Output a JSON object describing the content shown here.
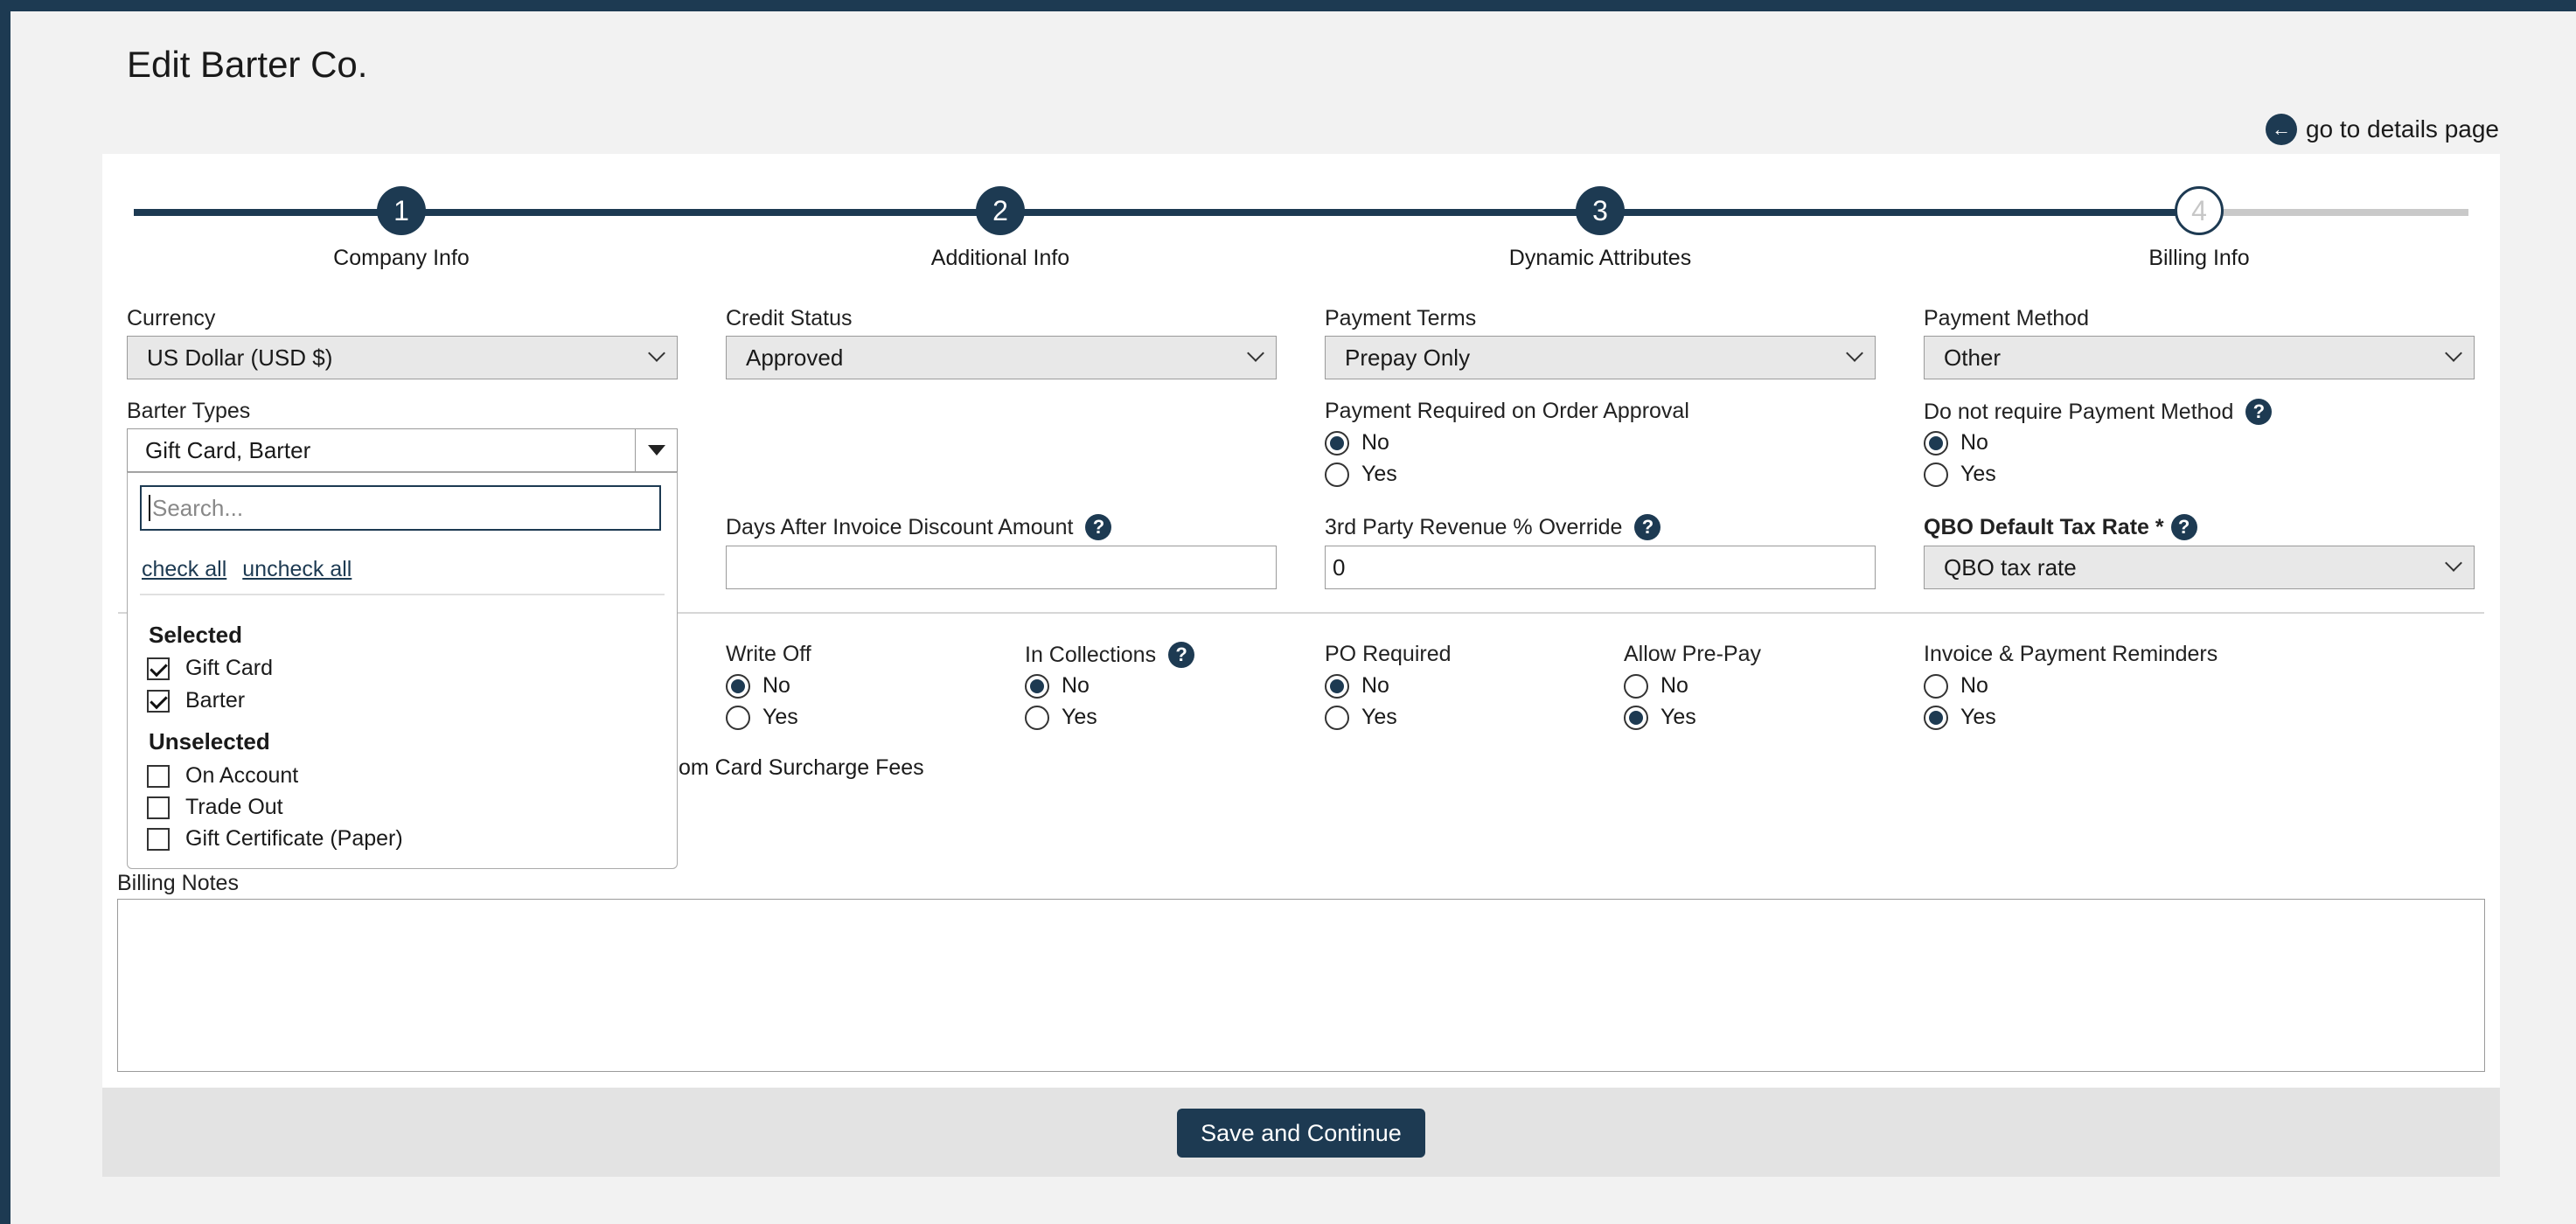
{
  "page": {
    "title": "Edit Barter Co.",
    "details_link": "go to details page"
  },
  "steps": [
    {
      "num": "1",
      "label": "Company Info"
    },
    {
      "num": "2",
      "label": "Additional Info"
    },
    {
      "num": "3",
      "label": "Dynamic Attributes"
    },
    {
      "num": "4",
      "label": "Billing Info"
    }
  ],
  "fields": {
    "currency": {
      "label": "Currency",
      "value": "US Dollar (USD $)"
    },
    "credit_status": {
      "label": "Credit Status",
      "value": "Approved"
    },
    "payment_terms": {
      "label": "Payment Terms",
      "value": "Prepay Only"
    },
    "payment_method": {
      "label": "Payment Method",
      "value": "Other"
    },
    "barter_types": {
      "label": "Barter Types",
      "value": "Gift Card, Barter"
    },
    "payment_required": {
      "label": "Payment Required on Order Approval",
      "no": "No",
      "yes": "Yes"
    },
    "no_payment_method": {
      "label": "Do not require Payment Method",
      "no": "No",
      "yes": "Yes"
    },
    "days_after_invoice": {
      "label": "Days After Invoice Discount Amount",
      "value": ""
    },
    "third_party": {
      "label": "3rd Party Revenue % Override",
      "value": "0"
    },
    "qbo_tax": {
      "label": "QBO Default Tax Rate *",
      "value": "QBO tax rate"
    },
    "write_off": {
      "label": "Write Off",
      "no": "No",
      "yes": "Yes"
    },
    "in_collections": {
      "label": "In Collections",
      "no": "No",
      "yes": "Yes"
    },
    "po_required": {
      "label": "PO Required",
      "no": "No",
      "yes": "Yes"
    },
    "allow_prepay": {
      "label": "Allow Pre-Pay",
      "no": "No",
      "yes": "Yes"
    },
    "reminders": {
      "label": "Invoice & Payment Reminders",
      "no": "No",
      "yes": "Yes"
    },
    "surcharge_partial": "om Card Surcharge Fees",
    "billing_notes": {
      "label": "Billing Notes"
    }
  },
  "dropdown": {
    "search_placeholder": "Search...",
    "check_all": "check all",
    "uncheck_all": "uncheck all",
    "selected_heading": "Selected",
    "unselected_heading": "Unselected",
    "selected": [
      "Gift Card",
      "Barter"
    ],
    "unselected": [
      "On Account",
      "Trade Out",
      "Gift Certificate (Paper)"
    ]
  },
  "help_glyph": "?",
  "back_glyph": "←",
  "save_label": "Save and Continue"
}
